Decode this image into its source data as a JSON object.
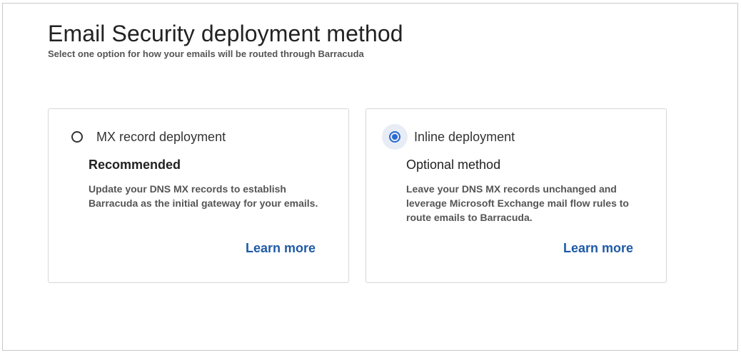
{
  "header": {
    "title": "Email Security deployment method",
    "subtitle": "Select one option for how your emails will be routed through Barracuda"
  },
  "options": [
    {
      "label": "MX record deployment",
      "tag": "Recommended",
      "description": "Update your DNS MX records to establish Barracuda as the initial gateway for your emails.",
      "link": "Learn more",
      "selected": false
    },
    {
      "label": "Inline deployment",
      "tag": "Optional method",
      "description": "Leave your DNS MX records unchanged and leverage Microsoft Exchange mail flow rules to route emails to Barracuda.",
      "link": "Learn more",
      "selected": true
    }
  ],
  "colors": {
    "accent": "#2a6ad1",
    "link": "#1f5aa6",
    "border": "#d6d6d6"
  }
}
